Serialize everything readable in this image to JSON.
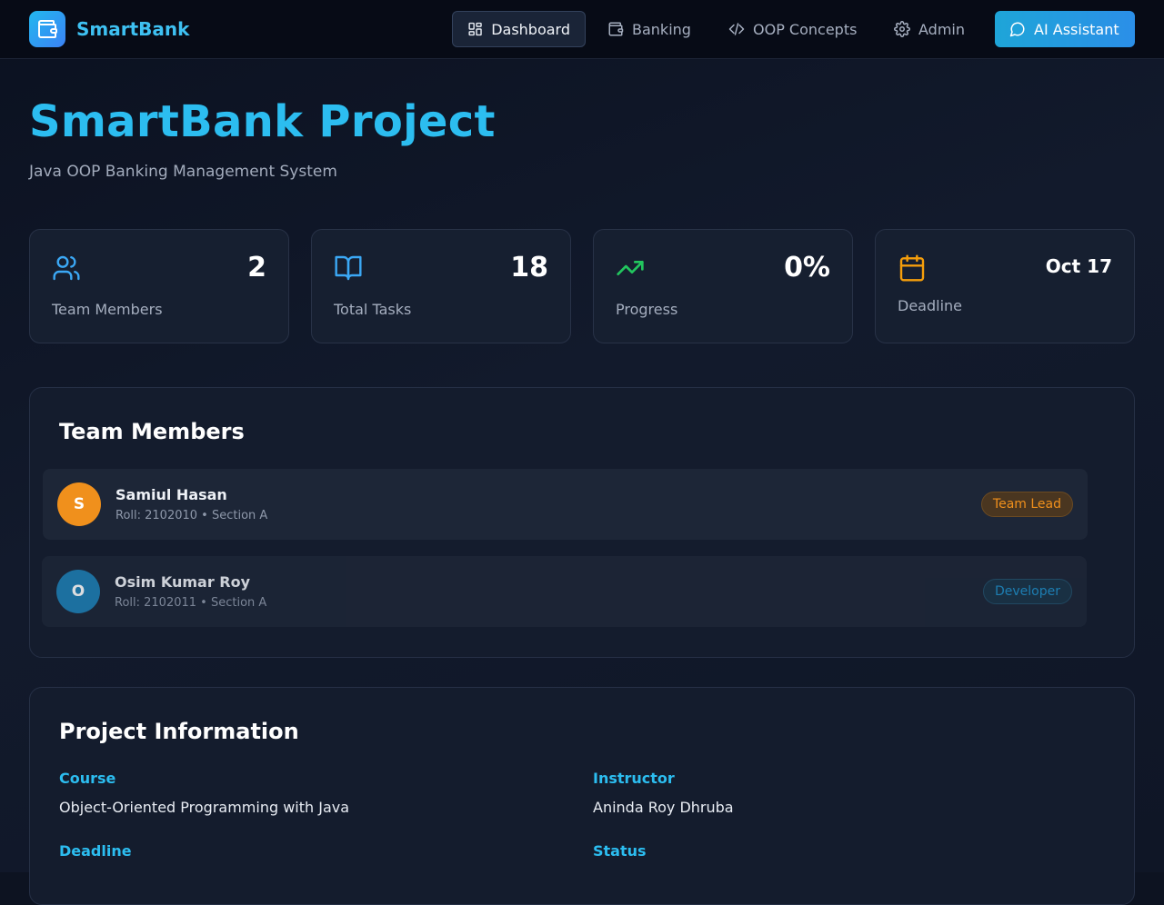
{
  "navbar": {
    "brand_name": "SmartBank",
    "items": [
      {
        "label": "Dashboard",
        "icon": "dashboard-grid-icon",
        "active": true
      },
      {
        "label": "Banking",
        "icon": "wallet-icon"
      },
      {
        "label": "OOP Concepts",
        "icon": "code-icon"
      },
      {
        "label": "Admin",
        "icon": "gear-icon"
      }
    ],
    "ai_button_label": "AI Assistant"
  },
  "hero": {
    "title": "SmartBank Project",
    "subtitle": "Java OOP Banking Management System"
  },
  "stats": [
    {
      "icon": "users-icon",
      "value": "2",
      "label": "Team Members",
      "color": "#3ba8f5"
    },
    {
      "icon": "book-open-icon",
      "value": "18",
      "label": "Total Tasks",
      "color": "#3ba8f5"
    },
    {
      "icon": "trending-up-icon",
      "value": "0%",
      "label": "Progress",
      "color": "#22c55e"
    },
    {
      "icon": "calendar-icon",
      "value": "Oct 17",
      "label": "Deadline",
      "color": "#f59e0b"
    }
  ],
  "team": {
    "title": "Team Members",
    "members": [
      {
        "initial": "S",
        "name": "Samiul Hasan",
        "meta": "Roll: 2102010 • Section A",
        "role": "Team Lead",
        "avatar_color": "#f0901c",
        "role_color": "#f0901c"
      },
      {
        "initial": "O",
        "name": "Osim Kumar Roy",
        "meta": "Roll: 2102011 • Section A",
        "role": "Developer",
        "avatar_color": "#1e7fb5",
        "role_color": "#1f8fc9"
      }
    ]
  },
  "project_info": {
    "title": "Project Information",
    "fields": [
      {
        "label": "Course",
        "value": "Object-Oriented Programming with Java"
      },
      {
        "label": "Instructor",
        "value": "Aninda Roy Dhruba"
      },
      {
        "label": "Deadline",
        "value": ""
      },
      {
        "label": "Status",
        "value": ""
      }
    ]
  }
}
